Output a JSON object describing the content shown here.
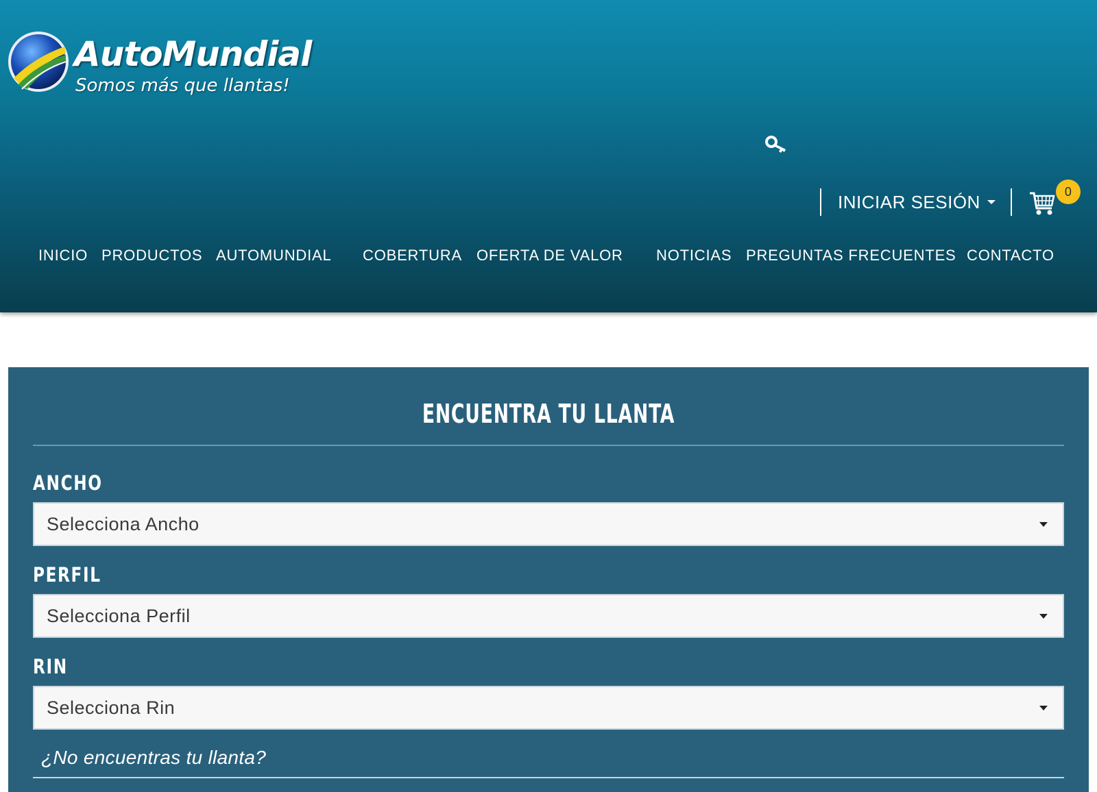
{
  "brand": {
    "name": "AutoMundial",
    "tagline": "Somos más que llantas!",
    "colors": {
      "header_top": "#108cb0",
      "header_bottom": "#093e4e",
      "panel": "#29617c",
      "badge": "#f6c21a"
    }
  },
  "header": {
    "search_icon": "search-icon",
    "login_label": "INICIAR SESIÓN",
    "cart_icon": "cart-icon",
    "cart_count": "0"
  },
  "nav": {
    "items": [
      {
        "label": "INICIO"
      },
      {
        "label": "PRODUCTOS"
      },
      {
        "label": "AUTOMUNDIAL"
      },
      {
        "label": "COBERTURA"
      },
      {
        "label": "OFERTA DE VALOR"
      },
      {
        "label": "NOTICIAS"
      },
      {
        "label": "PREGUNTAS FRECUENTES"
      },
      {
        "label": "CONTACTO"
      }
    ]
  },
  "finder": {
    "title": "Encuentra tu llanta",
    "fields": [
      {
        "label": "ANCHO",
        "placeholder": "Selecciona Ancho"
      },
      {
        "label": "PERFIL",
        "placeholder": "Selecciona Perfil"
      },
      {
        "label": "RIN",
        "placeholder": "Selecciona Rin"
      }
    ],
    "not_found_link": "¿No encuentras tu llanta?"
  }
}
